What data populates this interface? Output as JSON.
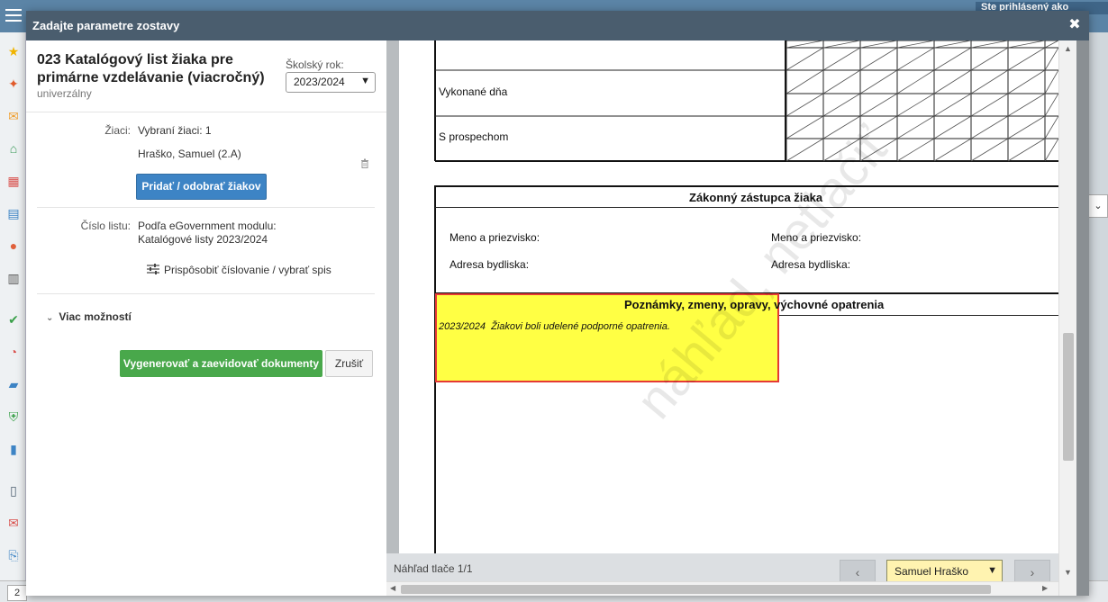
{
  "app": {
    "user_label": "Ste prihlásený ako",
    "pager_value": "2"
  },
  "modal": {
    "title": "Zadajte parametre zostavy",
    "close_label": "✖"
  },
  "report": {
    "title": "023 Katalógový list žiaka pre primárne vzdelávanie (viacročný)",
    "subtitle": "univerzálny",
    "year_label": "Školský rok:",
    "year_value": "2023/2024"
  },
  "students": {
    "label": "Žiaci:",
    "selected": "Vybraní žiaci: 1",
    "student_name": "Hraško, Samuel (2.A)",
    "add_remove_label": "Pridať / odobrať žiakov"
  },
  "sheet_number": {
    "label": "Číslo listu:",
    "line1": "Podľa eGovernment modulu:",
    "line2": "Katalógové listy 2023/2024",
    "customize_label": "Prispôsobiť číslovanie / vybrať spis"
  },
  "more_options_label": "Viac možností",
  "actions": {
    "generate_label": "Vygenerovať a zaevidovať dokumenty",
    "cancel_label": "Zrušiť"
  },
  "preview": {
    "row_vykonane": "Vykonané dňa",
    "row_prospech": "S prospechom",
    "guardian_header": "Zákonný zástupca žiaka",
    "name_label_1": "Meno a priezvisko:",
    "name_label_2": "Meno a priezvisko:",
    "address_label_1": "Adresa bydliska:",
    "address_label_2": "Adresa bydliska:",
    "notes_header": "Poznámky, zmeny, opravy, výchovné opatrenia",
    "note_year": "2023/2024",
    "note_text": "Žiakovi boli udelené podporné opatrenia.",
    "watermark": "náhľad, netlačiť",
    "page_info": "Náhľad tlače 1/1",
    "prev_label": "‹",
    "next_label": "›",
    "student_select": "Samuel Hraško"
  },
  "colors": {
    "header_bg": "#4a5d6e",
    "primary_button": "#3d84c5",
    "success_button": "#49a84b",
    "note_highlight": "#ffff44",
    "note_border": "#e53935"
  }
}
